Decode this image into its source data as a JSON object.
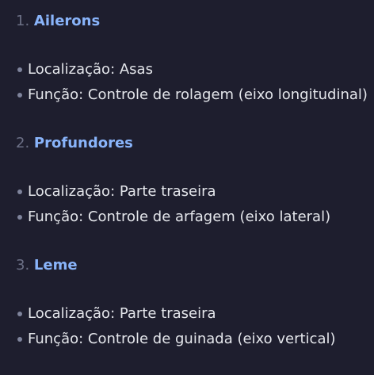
{
  "sections": [
    {
      "number": "1.",
      "title": "Ailerons",
      "items": [
        "Localização: Asas",
        "Função: Controle de rolagem (eixo longitudinal)"
      ]
    },
    {
      "number": "2.",
      "title": "Profundores",
      "items": [
        "Localização: Parte traseira",
        "Função: Controle de arfagem (eixo lateral)"
      ]
    },
    {
      "number": "3.",
      "title": "Leme",
      "items": [
        "Localização: Parte traseira",
        "Função: Controle de guinada (eixo vertical)"
      ]
    }
  ],
  "colors": {
    "background": "#1e1e2e",
    "text": "#e4e6eb",
    "heading_accent": "#89b4fa",
    "number_muted": "#6c7086",
    "bullet": "#7f849c"
  }
}
